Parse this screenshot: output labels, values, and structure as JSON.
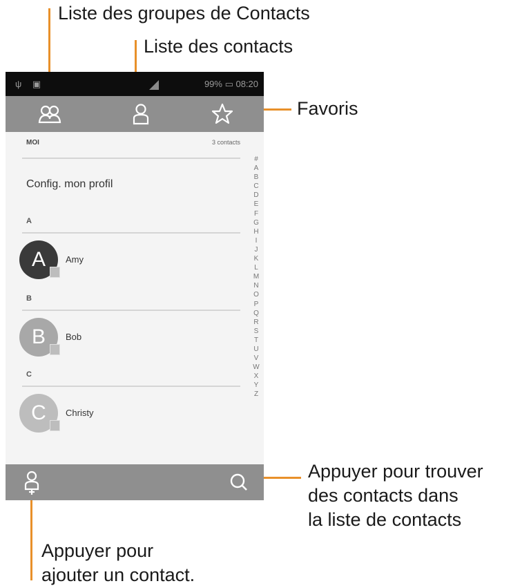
{
  "callouts": {
    "groups": "Liste des groupes de Contacts",
    "contacts": "Liste des contacts",
    "favorites": "Favoris",
    "search_line1": "Appuyer pour trouver",
    "search_line2": "des contacts dans",
    "search_line3": "la liste de contacts",
    "add_line1": "Appuyer pour",
    "add_line2": "ajouter un contact."
  },
  "status_bar": {
    "left": "ψ ▣",
    "right": "99% ▭ 08:20"
  },
  "tabs": [
    {
      "name": "groups",
      "icon": "group-icon"
    },
    {
      "name": "contacts",
      "icon": "person-icon"
    },
    {
      "name": "favorites",
      "icon": "star-icon"
    }
  ],
  "list": {
    "me_label": "MOI",
    "count": "3 contacts",
    "config_profile": "Config. mon profil",
    "sections": [
      {
        "letter": "A",
        "contact": {
          "name": "Amy",
          "initial": "A",
          "color": "#3a3a3a"
        }
      },
      {
        "letter": "B",
        "contact": {
          "name": "Bob",
          "initial": "B",
          "color": "#a8a8a8"
        }
      },
      {
        "letter": "C",
        "contact": {
          "name": "Christy",
          "initial": "C",
          "color": "#bdbdbd"
        }
      }
    ]
  },
  "alphabet": "# A B C D E F G H I J K L M N O P Q R S T U V W X Y Z",
  "bottom_bar": {
    "add_icon": "add-contact-icon",
    "search_icon": "search-icon"
  },
  "colors": {
    "callout_line": "#e8902a",
    "bar": "#8f8f8f",
    "status_bar": "#0d0d0d",
    "list_bg": "#f4f4f4"
  }
}
